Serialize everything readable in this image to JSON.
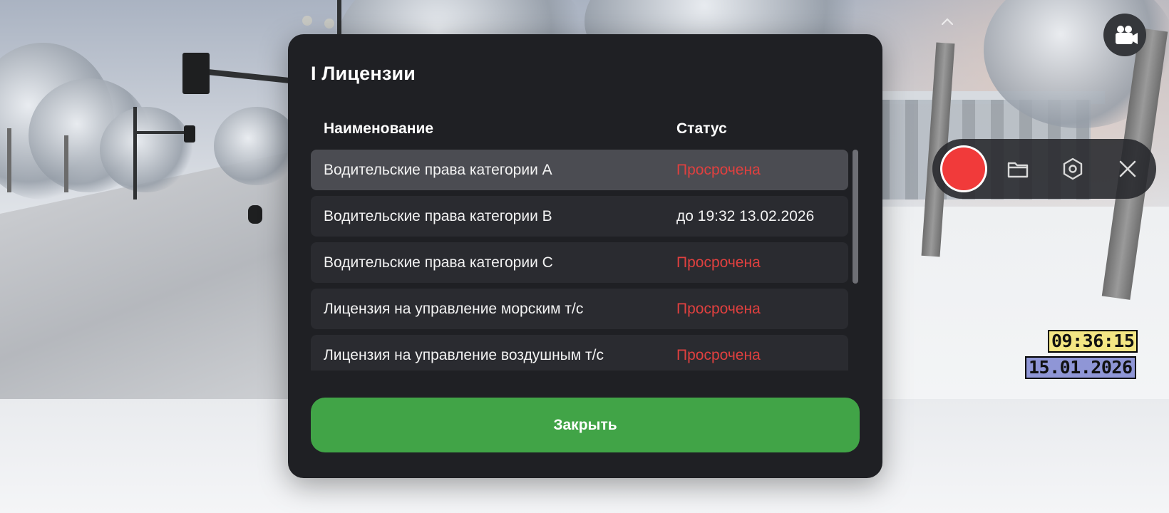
{
  "modal": {
    "title": "I Лицензии",
    "columns": {
      "name": "Наименование",
      "status": "Статус"
    },
    "rows": [
      {
        "name": "Водительские права категории A",
        "status": "Просрочена",
        "status_type": "expired",
        "selected": true
      },
      {
        "name": "Водительские права категории B",
        "status": "до 19:32 13.02.2026",
        "status_type": "valid",
        "selected": false
      },
      {
        "name": "Водительские права категории C",
        "status": "Просрочена",
        "status_type": "expired",
        "selected": false
      },
      {
        "name": "Лицензия на управление морским т/с",
        "status": "Просрочена",
        "status_type": "expired",
        "selected": false
      },
      {
        "name": "Лицензия на управление воздушным т/с",
        "status": "Просрочена",
        "status_type": "expired",
        "selected": false
      }
    ],
    "close_label": "Закрыть"
  },
  "overlay": {
    "time": "09:36:15",
    "date": "15.01.2026"
  },
  "recorder": {
    "icons": [
      "chevron-up-icon",
      "video-camera-icon",
      "record-icon",
      "folder-icon",
      "settings-hexagon-icon",
      "close-icon"
    ]
  },
  "colors": {
    "modal_bg": "#1f2024",
    "row_bg": "#2a2b30",
    "row_selected_bg": "#4b4c52",
    "expired": "#e0403f",
    "close_button": "#41a447",
    "record": "#f13a3a"
  }
}
